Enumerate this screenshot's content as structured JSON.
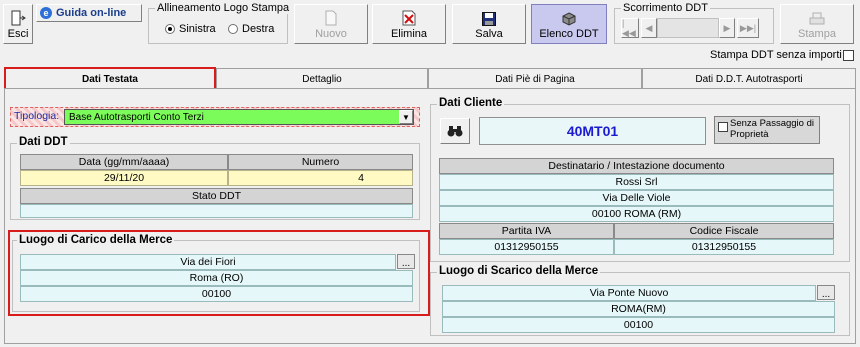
{
  "toolbar": {
    "exit_label": "Esci",
    "guide_label": "Guida on-line",
    "logo_align": {
      "title": "Allineamento Logo Stampa",
      "left": "Sinistra",
      "right": "Destra",
      "selected": "Sinistra"
    },
    "new_label": "Nuovo",
    "delete_label": "Elimina",
    "save_label": "Salva",
    "list_label": "Elenco DDT",
    "scroll_title": "Scorrimento DDT",
    "print_label": "Stampa",
    "no_amounts_label": "Stampa DDT senza importi"
  },
  "tabs": [
    {
      "label": "Dati Testata",
      "active": true
    },
    {
      "label": "Dettaglio",
      "active": false
    },
    {
      "label": "Dati Piè di Pagina",
      "active": false
    },
    {
      "label": "Dati D.D.T. Autotrasporti",
      "active": false
    }
  ],
  "tipologia": {
    "label": "Tipologia:",
    "value": "Base Autotrasporti Conto Terzi"
  },
  "dati_ddt": {
    "title": "Dati DDT",
    "date_header": "Data (gg/mm/aaaa)",
    "date_value": "29/11/20",
    "number_header": "Numero",
    "number_value": "4",
    "state_header": "Stato DDT",
    "state_value": ""
  },
  "carico": {
    "title": "Luogo di Carico della Merce",
    "address": "Via dei Fiori",
    "city": "Roma (RO)",
    "cap": "00100"
  },
  "cliente": {
    "title": "Dati Cliente",
    "code": "40MT01",
    "no_transfer_label": "Senza Passaggio di Proprietà",
    "dest_header": "Destinatario / Intestazione documento",
    "name": "Rossi Srl",
    "address": "Via Delle Viole",
    "city": "00100  ROMA (RM)",
    "piva_header": "Partita IVA",
    "piva": "01312950155",
    "cf_header": "Codice Fiscale",
    "cf": "01312950155"
  },
  "scarico": {
    "title": "Luogo di Scarico della Merce",
    "address": "Via Ponte Nuovo",
    "city": "ROMA(RM)",
    "cap": "00100"
  },
  "colors": {
    "highlight_red": "#d81b1b",
    "combo_green": "#7cfc5a",
    "code_blue": "#1a1ad0",
    "list_button_bg": "#c9c9ef"
  }
}
